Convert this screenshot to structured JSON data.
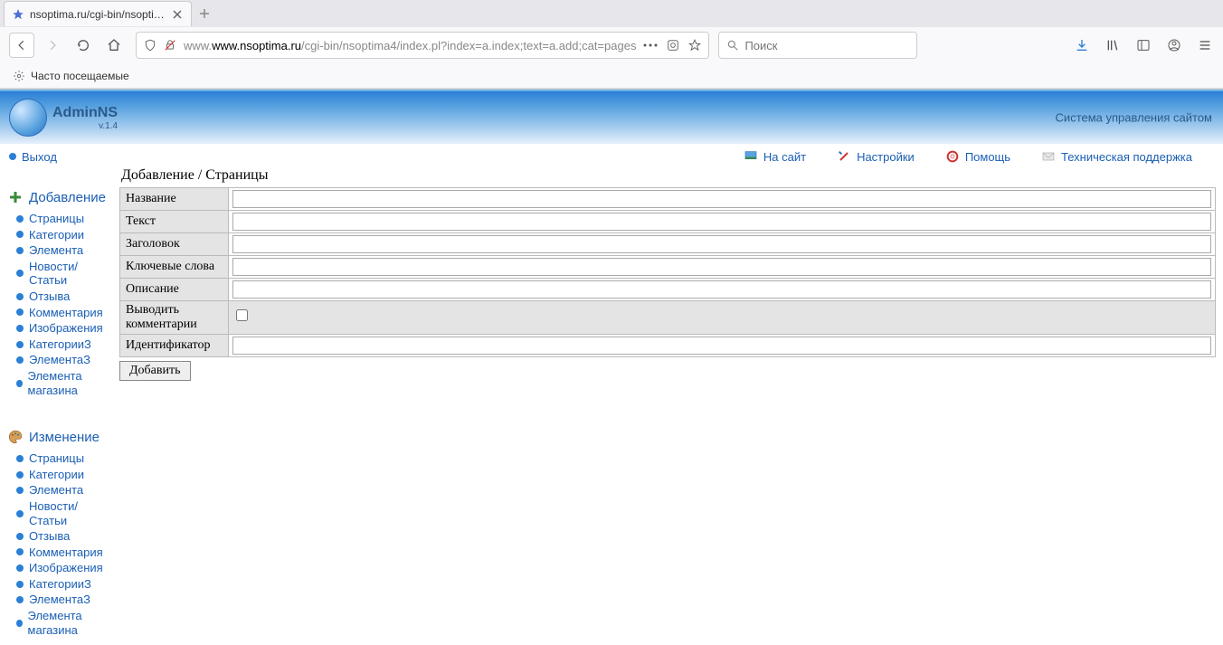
{
  "browser": {
    "tab_title": "nsoptima.ru/cgi-bin/nsoptima",
    "url_host": "www.nsoptima.ru",
    "url_path": "/cgi-bin/nsoptima4/index.pl?index=a.index;text=a.add;cat=pages",
    "search_placeholder": "Поиск",
    "bookmarks_label": "Часто посещаемые"
  },
  "header": {
    "product": "AdminNS",
    "version": "v.1.4",
    "subtitle": "Система управления сайтом"
  },
  "logout": "Выход",
  "toplinks": {
    "site": "На сайт",
    "settings": "Настройки",
    "help": "Помощь",
    "support": "Техническая поддержка"
  },
  "sidebar": {
    "add_title": "Добавление",
    "edit_title": "Изменение",
    "items": [
      "Страницы",
      "Категории",
      "Элемента",
      "Новости/Статьи",
      "Отзыва",
      "Комментария",
      "Изображения",
      "КатегорииЗ",
      "ЭлементаЗ",
      "Элемента магазина"
    ]
  },
  "main": {
    "title": "Добавление / Страницы",
    "fields": {
      "name": "Название",
      "text": "Текст",
      "heading": "Заголовок",
      "keywords": "Ключевые слова",
      "description": "Описание",
      "comments": "Выводить комментарии",
      "identifier": "Идентификатор"
    },
    "submit": "Добавить"
  }
}
